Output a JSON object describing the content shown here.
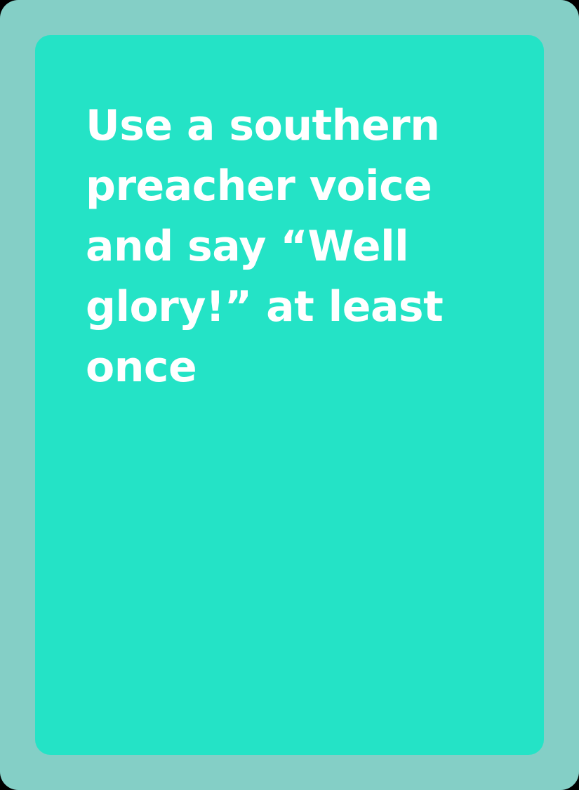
{
  "card": {
    "text": "Use a southern\npreacher voice\nand say “Well\nglory!” at least\nonce",
    "colors": {
      "frame": "#84cfc6",
      "face": "#24e3c6",
      "text": "#ffffff"
    }
  }
}
